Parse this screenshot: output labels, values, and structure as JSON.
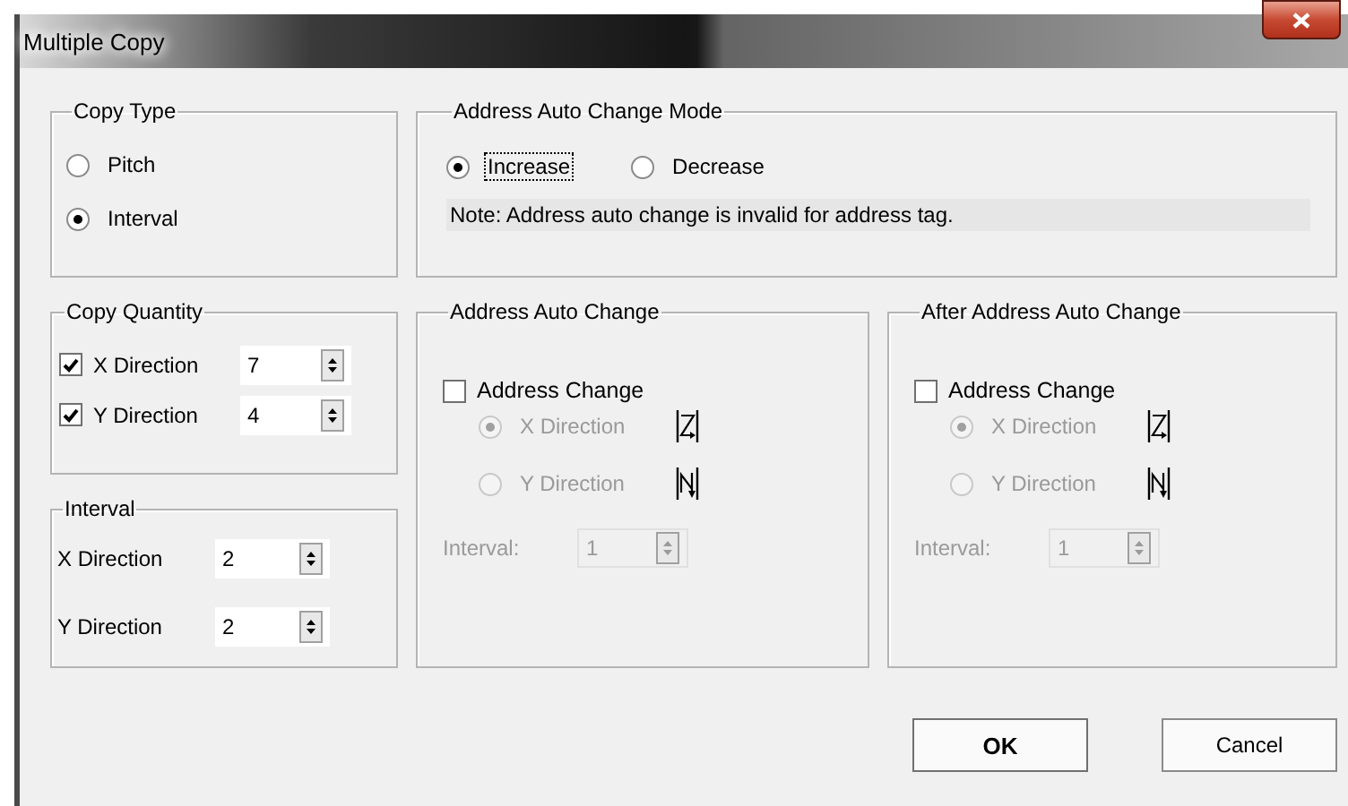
{
  "window": {
    "title": "Multiple Copy"
  },
  "copy_type": {
    "title": "Copy Type",
    "options": [
      {
        "label": "Pitch",
        "selected": false
      },
      {
        "label": "Interval",
        "selected": true
      }
    ]
  },
  "copy_quantity": {
    "title": "Copy Quantity",
    "rows": [
      {
        "label": "X Direction",
        "checked": true,
        "value": "7"
      },
      {
        "label": "Y Direction",
        "checked": true,
        "value": "4"
      }
    ]
  },
  "interval": {
    "title": "Interval",
    "rows": [
      {
        "label": "X Direction",
        "value": "2"
      },
      {
        "label": "Y Direction",
        "value": "2"
      }
    ]
  },
  "address_mode": {
    "title": "Address Auto Change Mode",
    "options": [
      {
        "label": "Increase",
        "selected": true,
        "focused": true
      },
      {
        "label": "Decrease",
        "selected": false,
        "focused": false
      }
    ],
    "note": "Note: Address auto change is invalid for address tag."
  },
  "address_panels": [
    {
      "title": "Address Auto Change",
      "checkbox": {
        "label": "Address Change",
        "checked": false
      },
      "directions": [
        {
          "label": "X Direction",
          "selected": true,
          "disabled": true
        },
        {
          "label": "Y Direction",
          "selected": false,
          "disabled": true
        }
      ],
      "interval": {
        "label": "Interval:",
        "value": "1",
        "disabled": true
      }
    },
    {
      "title": "After Address Auto Change",
      "checkbox": {
        "label": "Address Change",
        "checked": false
      },
      "directions": [
        {
          "label": "X Direction",
          "selected": true,
          "disabled": true
        },
        {
          "label": "Y Direction",
          "selected": false,
          "disabled": true
        }
      ],
      "interval": {
        "label": "Interval:",
        "value": "1",
        "disabled": true
      }
    }
  ],
  "buttons": [
    {
      "label": "OK",
      "kind": "default"
    },
    {
      "label": "Cancel",
      "kind": "normal"
    }
  ]
}
